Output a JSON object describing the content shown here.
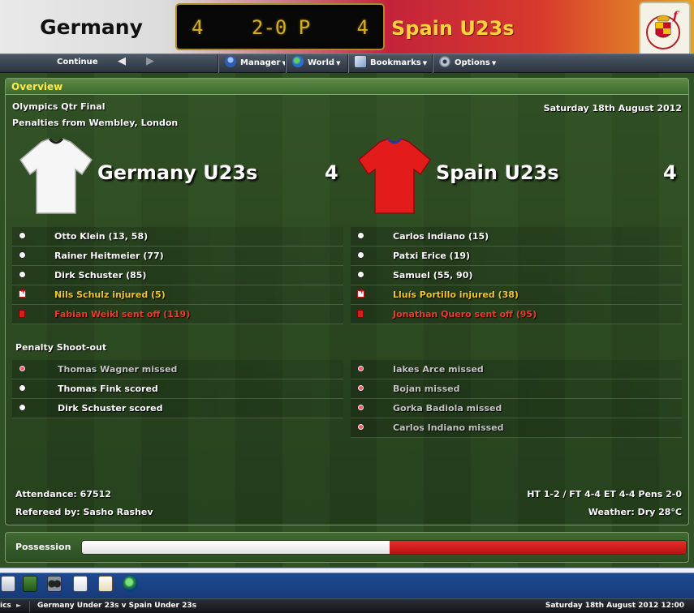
{
  "header": {
    "home_team": "Germany U23s",
    "away_team": "Spain U23s",
    "home_score": "4",
    "away_score": "4",
    "center_display": "2-0 P",
    "crest_icon": "spain-federation-crest-icon"
  },
  "toolbar": {
    "continue_label": "Continue",
    "back_icon": "back-arrow-icon",
    "forward_icon": "forward-arrow-icon",
    "menus": [
      "Manager",
      "World",
      "Bookmarks",
      "Options"
    ]
  },
  "overview": {
    "title": "Overview",
    "competition": "Olympics Qtr Final",
    "venue": "Penalties from Wembley, London",
    "date": "Saturday 18th August 2012",
    "home": {
      "name": "Germany U23s",
      "score": "4",
      "shirt_color": "#ffffff",
      "events": [
        {
          "icon": "goal-ball-icon",
          "text": "Otto Klein (13, 58)",
          "type": "goal"
        },
        {
          "icon": "goal-ball-icon",
          "text": "Rainer Heitmeier (77)",
          "type": "goal"
        },
        {
          "icon": "goal-ball-icon",
          "text": "Dirk Schuster (85)",
          "type": "goal"
        },
        {
          "icon": "injury-icon",
          "text": "Nils Schulz injured (5)",
          "type": "injury"
        },
        {
          "icon": "red-card-icon",
          "text": "Fabian Weikl sent off (119)",
          "type": "red"
        }
      ],
      "penalties": [
        {
          "icon": "penalty-missed-icon",
          "text": "Thomas Wagner missed",
          "type": "missed"
        },
        {
          "icon": "penalty-scored-icon",
          "text": "Thomas Fink scored",
          "type": "scored"
        },
        {
          "icon": "penalty-scored-icon",
          "text": "Dirk Schuster scored",
          "type": "scored"
        }
      ]
    },
    "away": {
      "name": "Spain U23s",
      "score": "4",
      "shirt_color": "#e41b1b",
      "events": [
        {
          "icon": "goal-ball-icon",
          "text": "Carlos Indiano (15)",
          "type": "goal"
        },
        {
          "icon": "goal-ball-icon",
          "text": "Patxi Erice (19)",
          "type": "goal"
        },
        {
          "icon": "goal-ball-icon",
          "text": "Samuel (55, 90)",
          "type": "goal"
        },
        {
          "icon": "injury-icon",
          "text": "Lluís Portillo injured (38)",
          "type": "injury"
        },
        {
          "icon": "red-card-icon",
          "text": "Jonathan Quero sent off (95)",
          "type": "red"
        }
      ],
      "penalties": [
        {
          "icon": "penalty-missed-icon",
          "text": "Iakes Arce missed",
          "type": "missed"
        },
        {
          "icon": "penalty-missed-icon",
          "text": "Bojan missed",
          "type": "missed"
        },
        {
          "icon": "penalty-missed-icon",
          "text": "Gorka Badiola missed",
          "type": "missed"
        },
        {
          "icon": "penalty-missed-icon",
          "text": "Carlos Indiano missed",
          "type": "missed"
        }
      ]
    },
    "penalty_label": "Penalty Shoot-out",
    "attendance": "Attendance: 67512",
    "referee": "Refereed by: Sasho Rashev",
    "summary": "HT 1-2 / FT 4-4 ET 4-4 Pens 2-0",
    "weather": "Weather: Dry 28°C"
  },
  "possession": {
    "label": "Possession",
    "home_fraction": 0.51,
    "away_fraction": 0.49,
    "home_color": "#ffffff",
    "away_color": "#e02525"
  },
  "taskbar": {
    "icons": [
      "notes-icon",
      "tactics-icon",
      "scout-binoculars-icon",
      "report-icon",
      "clipboard-icon",
      "world-globe-icon"
    ]
  },
  "statusbar": {
    "left_text": "ics",
    "match_title": "Germany Under 23s v Spain Under 23s",
    "datetime": "Saturday 18th August 2012 12:00"
  }
}
